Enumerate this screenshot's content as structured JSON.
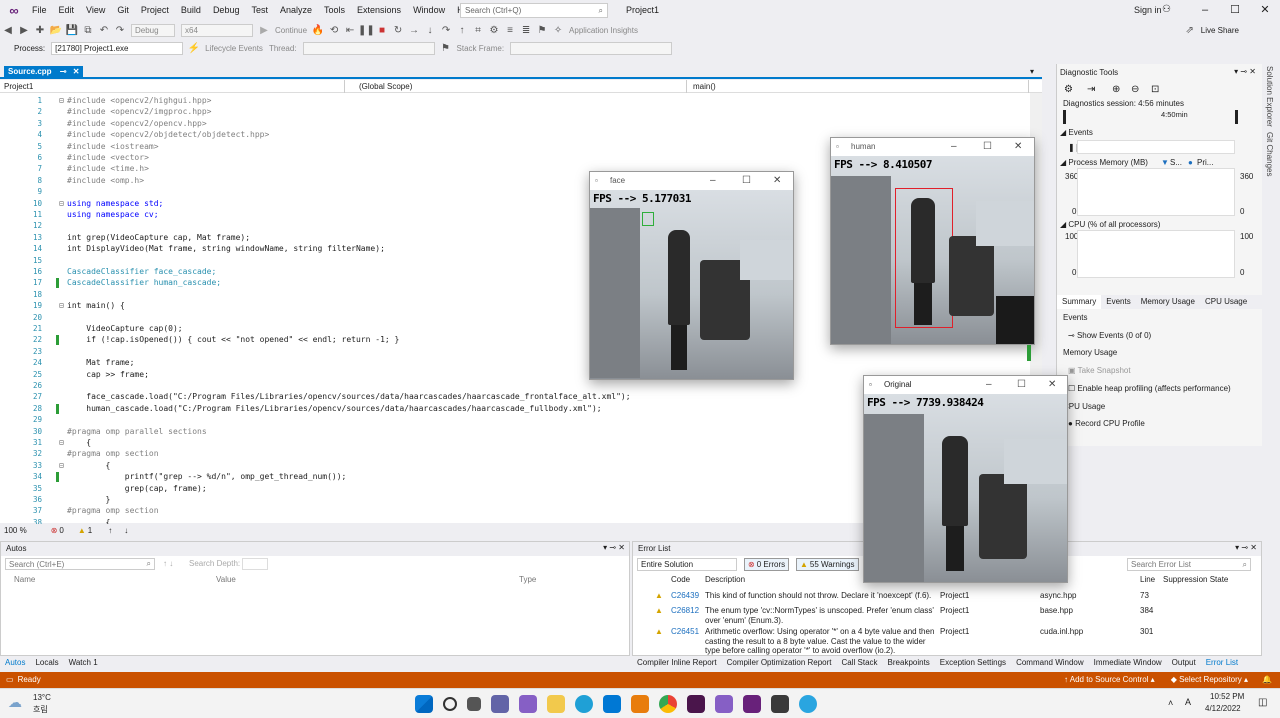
{
  "menubar": {
    "items": [
      "File",
      "Edit",
      "View",
      "Git",
      "Project",
      "Build",
      "Debug",
      "Test",
      "Analyze",
      "Tools",
      "Extensions",
      "Window",
      "Help"
    ],
    "search_placeholder": "Search (Ctrl+Q)",
    "window_title": "Project1",
    "signin": "Sign in"
  },
  "toolbar": {
    "config": "Debug",
    "platform": "x64",
    "continue": "Continue",
    "app_insights": "Application Insights",
    "live_share": "Live Share",
    "process_label": "Process:",
    "process_value": "[21780] Project1.exe",
    "lifecycle": "Lifecycle Events",
    "thread_label": "Thread:",
    "stack_frame": "Stack Frame:"
  },
  "editor": {
    "tab": "Source.cpp",
    "nav_project": "Project1",
    "nav_scope": "(Global Scope)",
    "nav_member": "main()",
    "zoom": "100 %",
    "errors": "0",
    "warnings": "1",
    "lines": [
      {
        "n": "1",
        "t": "#include <opencv2/highgui.hpp>",
        "c": "pp"
      },
      {
        "n": "2",
        "t": "#include <opencv2/imgproc.hpp>",
        "c": "pp"
      },
      {
        "n": "3",
        "t": "#include <opencv2/opencv.hpp>",
        "c": "pp"
      },
      {
        "n": "4",
        "t": "#include <opencv2/objdetect/objdetect.hpp>",
        "c": "pp"
      },
      {
        "n": "5",
        "t": "#include <iostream>",
        "c": "pp"
      },
      {
        "n": "6",
        "t": "#include <vector>",
        "c": "pp"
      },
      {
        "n": "7",
        "t": "#include <time.h>",
        "c": "pp"
      },
      {
        "n": "8",
        "t": "#include <omp.h>",
        "c": "pp"
      },
      {
        "n": "9",
        "t": "",
        "c": ""
      },
      {
        "n": "10",
        "t": "using namespace std;",
        "c": "kw"
      },
      {
        "n": "11",
        "t": "using namespace cv;",
        "c": "kw"
      },
      {
        "n": "12",
        "t": "",
        "c": ""
      },
      {
        "n": "13",
        "t": "int grep(VideoCapture cap, Mat frame);",
        "c": ""
      },
      {
        "n": "14",
        "t": "int DisplayVideo(Mat frame, string windowName, string filterName);",
        "c": ""
      },
      {
        "n": "15",
        "t": "",
        "c": ""
      },
      {
        "n": "16",
        "t": "CascadeClassifier face_cascade;",
        "c": "ty"
      },
      {
        "n": "17",
        "t": "CascadeClassifier human_cascade;",
        "c": "ty"
      },
      {
        "n": "18",
        "t": "",
        "c": ""
      },
      {
        "n": "19",
        "t": "int main() {",
        "c": ""
      },
      {
        "n": "20",
        "t": "",
        "c": ""
      },
      {
        "n": "21",
        "t": "    VideoCapture cap(0);",
        "c": ""
      },
      {
        "n": "22",
        "t": "    if (!cap.isOpened()) { cout << \"not opened\" << endl; return -1; }",
        "c": ""
      },
      {
        "n": "23",
        "t": "",
        "c": ""
      },
      {
        "n": "24",
        "t": "    Mat frame;",
        "c": ""
      },
      {
        "n": "25",
        "t": "    cap >> frame;",
        "c": ""
      },
      {
        "n": "26",
        "t": "",
        "c": ""
      },
      {
        "n": "27",
        "t": "    face_cascade.load(\"C:/Program Files/Libraries/opencv/sources/data/haarcascades/haarcascade_frontalface_alt.xml\");",
        "c": ""
      },
      {
        "n": "28",
        "t": "    human_cascade.load(\"C:/Program Files/Libraries/opencv/sources/data/haarcascades/haarcascade_fullbody.xml\");",
        "c": ""
      },
      {
        "n": "29",
        "t": "",
        "c": ""
      },
      {
        "n": "30",
        "t": "#pragma omp parallel sections",
        "c": "pp"
      },
      {
        "n": "31",
        "t": "    {",
        "c": ""
      },
      {
        "n": "32",
        "t": "#pragma omp section",
        "c": "pp"
      },
      {
        "n": "33",
        "t": "        {",
        "c": ""
      },
      {
        "n": "34",
        "t": "            printf(\"grep --> %d/n\", omp_get_thread_num());",
        "c": ""
      },
      {
        "n": "35",
        "t": "            grep(cap, frame);",
        "c": ""
      },
      {
        "n": "36",
        "t": "        }",
        "c": ""
      },
      {
        "n": "37",
        "t": "#pragma omp section",
        "c": "pp"
      },
      {
        "n": "38",
        "t": "        {",
        "c": ""
      }
    ]
  },
  "autos": {
    "title": "Autos",
    "search_placeholder": "Search (Ctrl+E)",
    "search_depth": "Search Depth:",
    "cols": [
      "Name",
      "Value",
      "Type"
    ],
    "tabs": [
      "Autos",
      "Locals",
      "Watch 1"
    ]
  },
  "errorlist": {
    "title": "Error List",
    "scope": "Entire Solution",
    "errors_btn": "0 Errors",
    "warnings_btn": "55 Warnings",
    "search_placeholder": "Search Error List",
    "cols": [
      "Code",
      "Description",
      "Line",
      "Suppression State"
    ],
    "rows": [
      {
        "code": "C26439",
        "desc": "This kind of function should not throw. Declare it 'noexcept' (f.6).",
        "project": "Project1",
        "file": "async.hpp",
        "line": "73"
      },
      {
        "code": "C26812",
        "desc": "The enum type 'cv::NormTypes' is unscoped. Prefer 'enum class' over 'enum' (Enum.3).",
        "project": "Project1",
        "file": "base.hpp",
        "line": "384"
      },
      {
        "code": "C26451",
        "desc": "Arithmetic overflow: Using operator '*' on a 4 byte value and then casting the result to a 8 byte value. Cast the value to the wider type before calling operator '*' to avoid overflow (io.2).",
        "project": "Project1",
        "file": "cuda.inl.hpp",
        "line": "301"
      }
    ],
    "tabs": [
      "Compiler Inline Report",
      "Compiler Optimization Report",
      "Call Stack",
      "Breakpoints",
      "Exception Settings",
      "Command Window",
      "Immediate Window",
      "Output",
      "Error List"
    ]
  },
  "diagnostics": {
    "title": "Diagnostic Tools",
    "session": "Diagnostics session: 4:56 minutes",
    "timeline_label": "4:50min",
    "events": "Events",
    "process_memory": "Process Memory (MB)",
    "legend_s": "S...",
    "legend_pri": "Pri...",
    "mem_top": "360",
    "mem_bottom": "0",
    "cpu": "CPU (% of all processors)",
    "cpu_top": "100",
    "cpu_bottom": "0",
    "tabs": [
      "Summary",
      "Events",
      "Memory Usage",
      "CPU Usage"
    ],
    "events_section": "Events",
    "show_events": "Show Events (0 of 0)",
    "memory_section": "Memory Usage",
    "take_snapshot": "Take Snapshot",
    "heap_profiling": "Enable heap profiling (affects performance)",
    "cpu_section": "CPU Usage",
    "record_cpu": "Record CPU Profile",
    "side_tabs": [
      "Solution Explorer",
      "Git Changes"
    ]
  },
  "windows": {
    "face": {
      "title": "face",
      "fps": "FPS --> 5.177031"
    },
    "human": {
      "title": "human",
      "fps": "FPS --> 8.410507"
    },
    "original": {
      "title": "Original",
      "fps": "FPS --> 7739.938424"
    }
  },
  "statusbar": {
    "ready": "Ready",
    "add_source": "Add to Source Control",
    "select_repo": "Select Repository"
  },
  "taskbar": {
    "weather_temp": "13°C",
    "weather_desc": "흐림",
    "time": "10:52 PM",
    "date": "4/12/2022"
  }
}
